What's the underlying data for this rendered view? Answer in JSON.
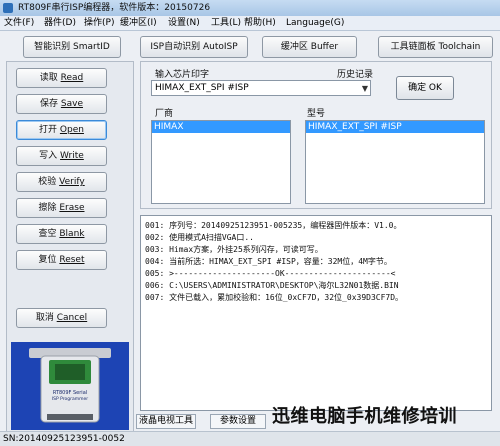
{
  "window": {
    "title": "RT809F串行ISP编程器，软件版本：20150726"
  },
  "menu": [
    "文件(F)",
    "器件(D)",
    "操作(P)",
    "缓冲区(I)",
    "设置(N)",
    "工具(L)",
    "帮助(H)",
    "Language(G)"
  ],
  "toolbar": {
    "smart_id": "智能识别 SmartID",
    "isp_auto": "ISP自动识别 AutoISP",
    "buffer": "缓冲区 Buffer",
    "toolchain": "工具链面板 Toolchain"
  },
  "sidebar": {
    "read": {
      "cn": "读取 ",
      "en": "Read"
    },
    "save": {
      "cn": "保存 ",
      "en": "Save"
    },
    "open": {
      "cn": "打开 ",
      "en": "Open"
    },
    "write": {
      "cn": "写入 ",
      "en": "Write"
    },
    "verify": {
      "cn": "校验 ",
      "en": "Verify"
    },
    "erase": {
      "cn": "擦除 ",
      "en": "Erase"
    },
    "blank": {
      "cn": "查空 ",
      "en": "Blank"
    },
    "reset": {
      "cn": "复位 ",
      "en": "Reset"
    },
    "cancel": {
      "cn": "取消 ",
      "en": "Cancel"
    }
  },
  "chip": {
    "input_label": "输入芯片印字",
    "history_label": "历史记录",
    "input_value": "HIMAX_EXT_SPI #ISP",
    "ok": "确定 OK",
    "vendor_label": "厂商",
    "model_label": "型号",
    "vendor_selected": "HIMAX",
    "model_selected": "HIMAX_EXT_SPI #ISP"
  },
  "log": [
    "001: 序列号：20140925123951-005235，编程器固件版本：V1.0。",
    "002: 使用模式A扫描VGA口..",
    "003: Himax方案，外挂25系列闪存，可读可写。",
    "004: 当前所选：HIMAX_EXT_SPI #ISP，容量：32M位，4M字节。",
    "005: >---------------------OK----------------------<",
    "006: C:\\USERS\\ADMINISTRATOR\\DESKTOP\\海尔L32N01数据.BIN",
    "007: 文件已载入，累加校验和：16位_0xCF7D，32位_0x39D3CF7D。"
  ],
  "tabs": {
    "lcd_tools": "液晶电视工具",
    "params": "参数设置"
  },
  "status": {
    "sn": "SN:20140925123951-0052"
  },
  "watermark": "迅维电脑手机维修培训",
  "device_labels": {
    "top": "RT809F Serial",
    "sub": "ISP Programmer"
  }
}
